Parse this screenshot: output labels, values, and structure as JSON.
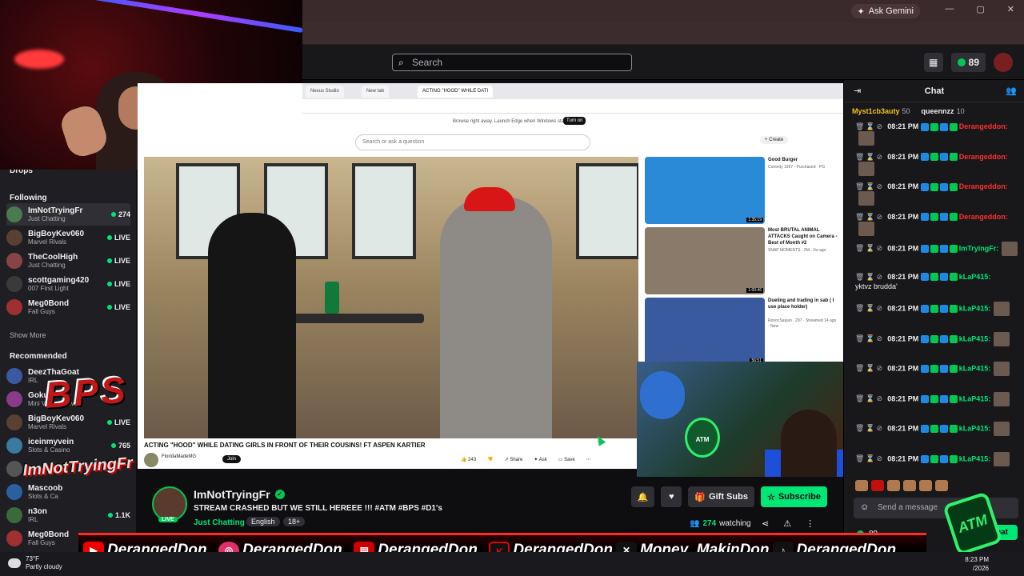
{
  "browser": {
    "gemini_label": "Ask Gemini"
  },
  "nav": {
    "search_placeholder": "Search",
    "points": "89"
  },
  "sidebar": {
    "partial_label": "Drops",
    "following_header": "Following",
    "following": [
      {
        "name": "ImNotTryingFr",
        "category": "Just Chatting",
        "live": "274",
        "color": "#4a7a50"
      },
      {
        "name": "BigBoyKev060",
        "category": "Marvel Rivals",
        "live": "LIVE",
        "color": "#5a4030"
      },
      {
        "name": "TheCoolHigh",
        "category": "Just Chatting",
        "live": "LIVE",
        "color": "#884444"
      },
      {
        "name": "scottgaming420",
        "category": "007 First Light",
        "live": "LIVE",
        "color": "#3a3a3a"
      },
      {
        "name": "Meg0Bond",
        "category": "Fall Guys",
        "live": "LIVE",
        "color": "#a03030"
      }
    ],
    "show_more": "Show More",
    "recommended_header": "Recommended",
    "recommended": [
      {
        "name": "DeezThaGoat",
        "category": "IRL",
        "live": "",
        "color": "#3a5aa0"
      },
      {
        "name": "Gokuu",
        "category": "Mini Vtuber Move",
        "live": "",
        "color": "#8a3a8a"
      },
      {
        "name": "BigBoyKev060",
        "category": "Marvel Rivals",
        "live": "LIVE",
        "color": "#5a4030"
      },
      {
        "name": "iceinmyvein",
        "category": "Slots & Casino",
        "live": "765",
        "color": "#3a7aa0"
      },
      {
        "name": "L",
        "category": "",
        "live": "",
        "color": "#555"
      },
      {
        "name": "Mascoob",
        "category": "Slots & Ca",
        "live": "",
        "color": "#2a60a0"
      },
      {
        "name": "n3on",
        "category": "IRL",
        "live": "1.1K",
        "color": "#3a6a3a"
      },
      {
        "name": "Meg0Bond",
        "category": "Fall Guys",
        "live": "LIVE",
        "color": "#a03030"
      }
    ]
  },
  "inner_browser": {
    "tabs": [
      "Nexus Studio",
      "New tab",
      "ACTING \"HOOD\" WHILE DATI"
    ],
    "banner_text": "Browse right away. Launch Edge when Windows starts",
    "banner_button": "Turn on",
    "yt_search_placeholder": "Search or ask a question",
    "yt_create": "+ Create",
    "video_title": "ACTING \"HOOD\" WHILE DATING GIRLS IN FRONT OF THEIR COUSINS! FT ASPEN KARTIER",
    "channel_name": "FloridaMadeMG",
    "join_label": "Join",
    "actions": [
      "243",
      "Share",
      "Ask",
      "Save"
    ],
    "recommendations": [
      {
        "title": "Good Burger",
        "meta": "Comedy 1997 · Purchased · PG",
        "duration": "1:35:19",
        "color": "#2a8ad8"
      },
      {
        "title": "Most BRUTAL ANIMAL ATTACKS Caught on Camera - Best of Month #2",
        "meta": "SNAP MOMENTS · 2M · 2w ago",
        "duration": "1:00:46",
        "color": "#8a7a6a"
      },
      {
        "title": "Dueling and trading in sab ( I use place holder)",
        "meta": "RonocSaiyan · 297 · Streamed 14 ago · New",
        "duration": "56:51",
        "color": "#3a5aa0"
      }
    ]
  },
  "stream": {
    "channel": "ImNotTryingFr",
    "live_badge": "LIVE",
    "title": "STREAM CRASHED BUT WE STILL HEREEE !!! #ATM #BPS #D1's",
    "category": "Just Chatting",
    "tags": [
      "English",
      "18+"
    ],
    "gift_subs": "Gift Subs",
    "subscribe": "Subscribe",
    "watching_count": "274",
    "watching_label": "watching"
  },
  "chat": {
    "title": "Chat",
    "leaderboard": [
      {
        "name": "Myst1cb3auty",
        "score": "50"
      },
      {
        "name": "queennzz",
        "score": "10"
      }
    ],
    "messages": [
      {
        "time": "08:21 PM",
        "user": "Derangeddon:",
        "color": "#ff3030",
        "body": "",
        "emote": true
      },
      {
        "time": "08:21 PM",
        "user": "Derangeddon:",
        "color": "#ff3030",
        "body": "",
        "emote": true
      },
      {
        "time": "08:21 PM",
        "user": "Derangeddon:",
        "color": "#ff3030",
        "body": "",
        "emote": true
      },
      {
        "time": "08:21 PM",
        "user": "Derangeddon:",
        "color": "#ff3030",
        "body": "",
        "emote": true
      },
      {
        "time": "08:21 PM",
        "user": "ImTryingFr:",
        "color": "#00e676",
        "body": "",
        "emote": true
      },
      {
        "time": "08:21 PM",
        "user": "kLaP415:",
        "color": "#00e676",
        "body": "yktvz brudda'",
        "emote": false
      },
      {
        "time": "08:21 PM",
        "user": "kLaP415:",
        "color": "#00e676",
        "body": "",
        "emote": true
      },
      {
        "time": "08:21 PM",
        "user": "kLaP415:",
        "color": "#00e676",
        "body": "",
        "emote": true
      },
      {
        "time": "08:21 PM",
        "user": "kLaP415:",
        "color": "#00e676",
        "body": "",
        "emote": true
      },
      {
        "time": "08:21 PM",
        "user": "kLaP415:",
        "color": "#00e676",
        "body": "",
        "emote": true
      },
      {
        "time": "08:21 PM",
        "user": "kLaP415:",
        "color": "#00e676",
        "body": "",
        "emote": true
      },
      {
        "time": "08:21 PM",
        "user": "kLaP415:",
        "color": "#00e676",
        "body": "",
        "emote": true
      }
    ],
    "input_placeholder": "Send a message",
    "points": "89",
    "chat_button": "Chat"
  },
  "overlay": {
    "logo_text": "BPS",
    "graffiti_text": "ImNotTryingFr",
    "atm_text": "ATM",
    "cam_sign": "ATM",
    "socials": [
      {
        "icon": "youtube-icon",
        "handle": "DerangedDon_"
      },
      {
        "icon": "instagram-icon",
        "handle": "DerangedDon_"
      },
      {
        "icon": "twitch-icon",
        "handle": "DerangedDon_"
      },
      {
        "icon": "kick-icon",
        "handle": "DerangedDon"
      },
      {
        "icon": "x-icon",
        "handle": "Money_MakinDon"
      },
      {
        "icon": "tiktok-icon",
        "handle": "DerangedDon_"
      }
    ]
  },
  "taskbar": {
    "temperature": "73°F",
    "weather": "Partly cloudy",
    "time": "8:23 PM",
    "date": "/2026"
  }
}
